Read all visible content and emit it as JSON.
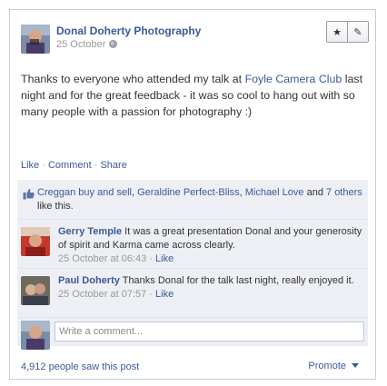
{
  "post": {
    "page_name": "Donal Doherty Photography",
    "date": "25 October",
    "message_before": "Thanks to everyone who attended my talk at ",
    "message_link": "Foyle Camera Club",
    "message_after": " last night and for the great feedback - it was so cool to hang out with so many people with a passion for photography :)"
  },
  "actions": {
    "like": "Like",
    "comment": "Comment",
    "share": "Share",
    "dot": "·"
  },
  "likes": {
    "names": [
      "Creggan buy and sell",
      "Geraldine Perfect-Bliss",
      "Michael Love"
    ],
    "joiner_comma": ", ",
    "joiner_and": " and ",
    "others": "7 others",
    "suffix": " like this."
  },
  "comments": [
    {
      "author": "Gerry Temple",
      "text": "It was a great presentation Donal and your generosity of spirit and Karma came across clearly.",
      "time": "25 October at 06:43",
      "like": "Like"
    },
    {
      "author": "Paul Doherty",
      "text": "Thanks Donal for the talk last night, really enjoyed it.",
      "time": "25 October at 07:57",
      "like": "Like"
    }
  ],
  "write_comment": {
    "placeholder": "Write a comment..."
  },
  "footer": {
    "seen": "4,912 people saw this post",
    "promote": "Promote"
  },
  "icons": {
    "star": "star-icon",
    "edit": "pencil-icon",
    "globe": "globe-icon",
    "thumb": "thumbs-up-icon",
    "caret": "chevron-down-icon"
  },
  "colors": {
    "link": "#3b5998",
    "ufi_background": "#edeff4",
    "meta_text": "#999999"
  }
}
